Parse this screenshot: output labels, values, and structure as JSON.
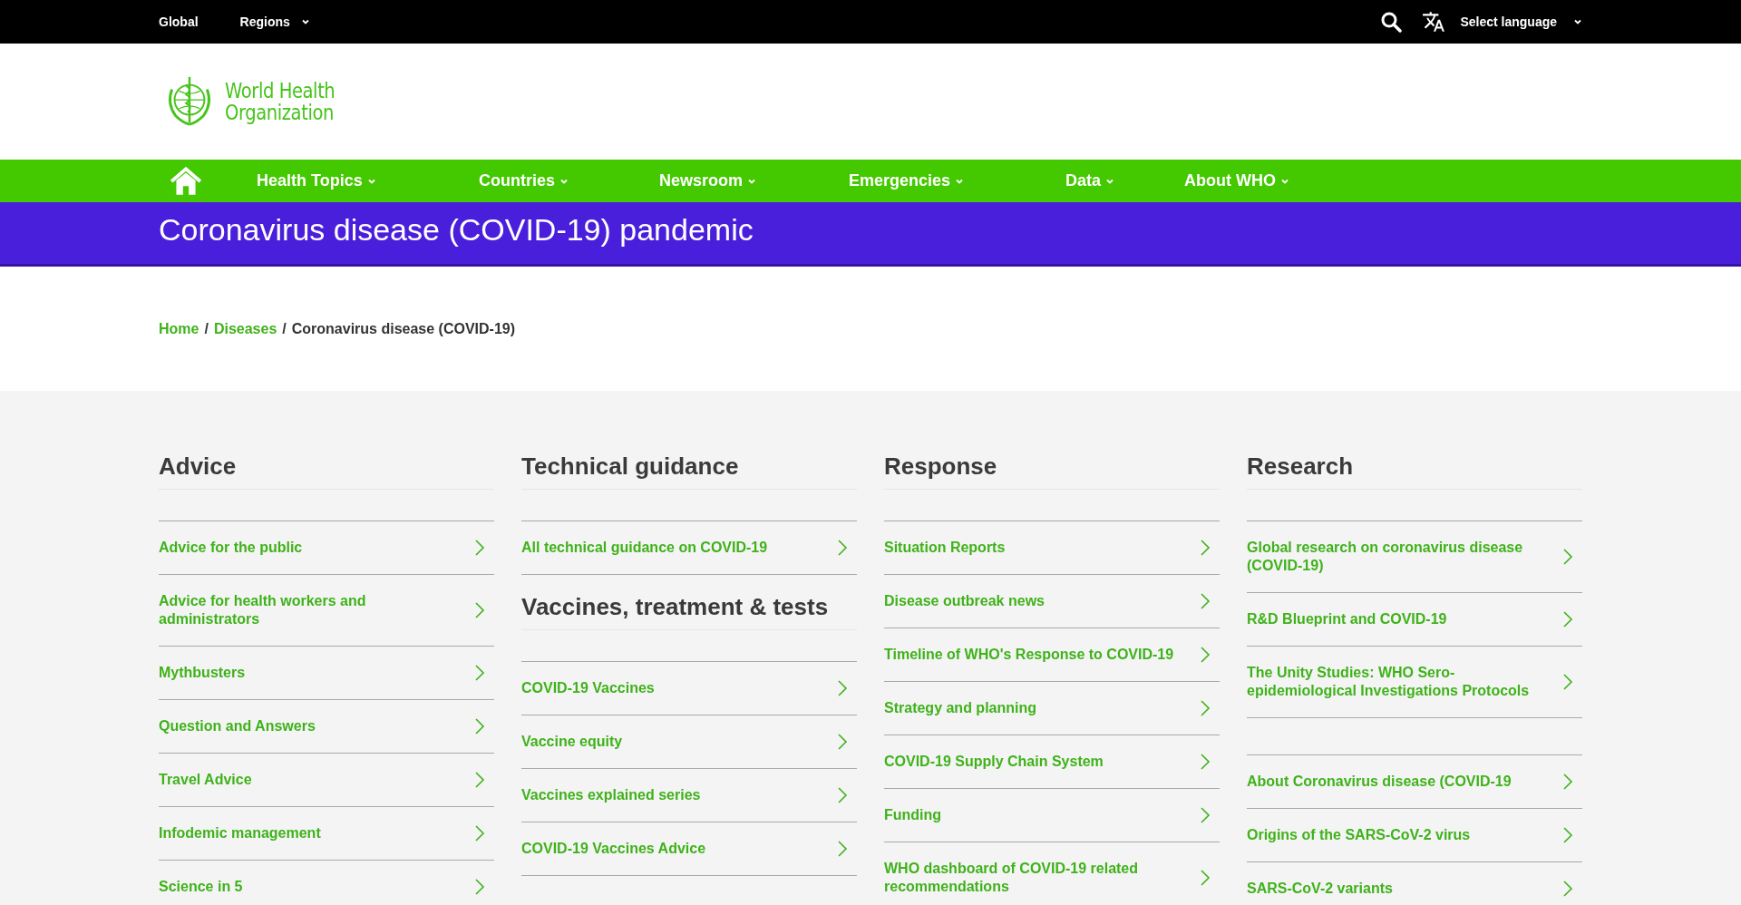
{
  "top_bar": {
    "left": [
      {
        "label": "Global",
        "dropdown": false
      },
      {
        "label": "Regions",
        "dropdown": true
      }
    ],
    "language": {
      "label": "Select language"
    }
  },
  "logo": {
    "line_1": "World Health",
    "line_2": "Organization"
  },
  "main_nav": [
    {
      "label": "Health Topics"
    },
    {
      "label": "Countries"
    },
    {
      "label": "Newsroom"
    },
    {
      "label": "Emergencies"
    },
    {
      "label": "Data"
    },
    {
      "label": "About WHO"
    }
  ],
  "banner": {
    "title": "Coronavirus disease (COVID-19) pandemic"
  },
  "breadcrumb": {
    "separator": "/",
    "items": [
      {
        "label": "Home",
        "kind": "link"
      },
      {
        "label": "Diseases",
        "kind": "link"
      },
      {
        "label": "Coronavirus disease (COVID-19)",
        "kind": "current"
      }
    ]
  },
  "columns": [
    {
      "sections": [
        {
          "heading": "Advice",
          "links": [
            "Advice for the public",
            "Advice for health workers and administrators",
            "Mythbusters",
            "Question and Answers",
            "Travel Advice",
            "Infodemic management",
            "Science in 5"
          ]
        }
      ]
    },
    {
      "sections": [
        {
          "heading": "Technical guidance",
          "links": [
            "All technical guidance on COVID-19"
          ]
        },
        {
          "heading": "Vaccines, treatment & tests",
          "links": [
            "COVID-19 Vaccines",
            "Vaccine equity",
            "Vaccines explained series",
            "COVID-19 Vaccines Advice"
          ]
        }
      ]
    },
    {
      "sections": [
        {
          "heading": "Response",
          "links": [
            "Situation Reports",
            "Disease outbreak news",
            "Timeline of WHO's Response to COVID-19",
            "Strategy and planning",
            "COVID-19 Supply Chain System",
            "Funding",
            "WHO dashboard of COVID-19 related recommendations"
          ]
        }
      ]
    },
    {
      "sections": [
        {
          "heading": "Research",
          "links": [
            "Global research on coronavirus disease (COVID-19)",
            "R&D Blueprint and COVID-19",
            "The Unity Studies: WHO Sero-epidemiological Investigations Protocols"
          ]
        },
        {
          "links": [
            "About Coronavirus disease (COVID-19",
            "Origins of the SARS-CoV-2 virus",
            "SARS-CoV-2 variants"
          ]
        }
      ]
    }
  ]
}
